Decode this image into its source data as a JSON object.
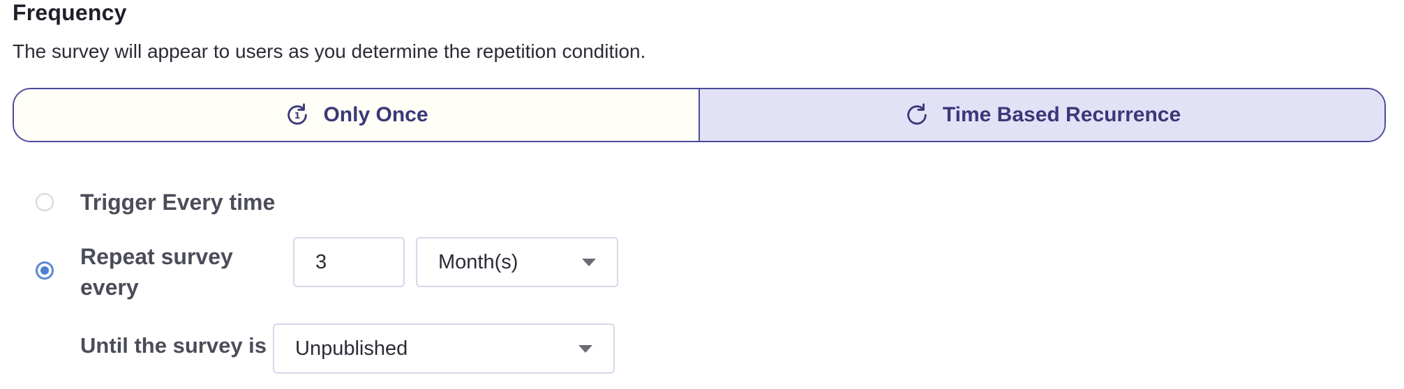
{
  "frequency": {
    "title": "Frequency",
    "description": "The survey will appear to users as you determine the repetition condition.",
    "tabs": [
      {
        "label": "Only Once",
        "icon": "repeat-once-icon",
        "selected": false
      },
      {
        "label": "Time Based Recurrence",
        "icon": "refresh-icon",
        "selected": true
      }
    ],
    "options": {
      "trigger_every_time": {
        "label": "Trigger Every time",
        "checked": false
      },
      "repeat_every": {
        "label_line1": "Repeat survey",
        "label_line2": "every",
        "checked": true,
        "interval_value": "3",
        "interval_unit": "Month(s)"
      }
    },
    "until": {
      "label": "Until the survey is",
      "value": "Unpublished"
    }
  },
  "colors": {
    "accent": "#4b4a9c",
    "selected_tab_bg": "#e3e1f6",
    "radio_checked": "#4f7fd6"
  }
}
